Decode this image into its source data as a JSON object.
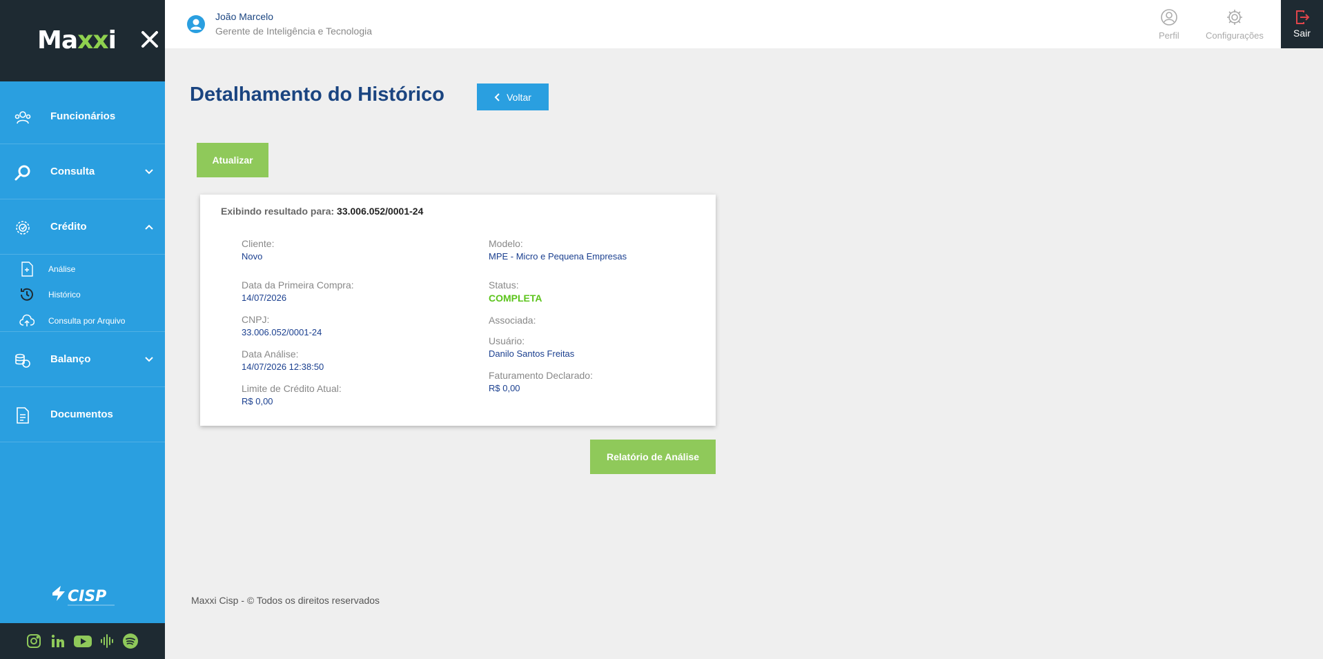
{
  "brand": {
    "logo_pre": "Ma",
    "logo_xx": "xx",
    "logo_post": "i",
    "accent": "#8fd14f"
  },
  "sidebar": {
    "items": [
      {
        "label": "Funcionários",
        "icon": "users-icon"
      },
      {
        "label": "Consulta",
        "icon": "search-icon"
      },
      {
        "label": "Crédito",
        "icon": "credit-gear-icon"
      },
      {
        "label": "Balanço",
        "icon": "coins-icon"
      },
      {
        "label": "Documentos",
        "icon": "document-icon"
      }
    ],
    "sub_items": [
      {
        "label": "Análise",
        "icon": "add-document-icon"
      },
      {
        "label": "Histórico",
        "icon": "history-icon"
      },
      {
        "label": "Consulta por Arquivo",
        "icon": "cloud-upload-icon"
      }
    ],
    "social": [
      "instagram-icon",
      "linkedin-icon",
      "youtube-icon",
      "podcast-icon",
      "spotify-icon"
    ]
  },
  "header": {
    "user_name": "João Marcelo",
    "user_role": "Gerente de Inteligência e Tecnologia",
    "perfil": "Perfil",
    "config": "Configurações",
    "sair": "Sair"
  },
  "main": {
    "title": "Detalhamento do Histórico",
    "back": "Voltar",
    "refresh": "Atualizar",
    "report": "Relatório de Análise",
    "result_prefix": "Exibindo resultado para:",
    "result_doc": "33.006.052/0001-24",
    "left": [
      {
        "k": "Cliente:",
        "v": "Novo"
      },
      {
        "k": "Data da Primeira Compra:",
        "v": "14/07/2026"
      },
      {
        "k": "CNPJ:",
        "v": "33.006.052/0001-24"
      },
      {
        "k": "Data Análise:",
        "v": "14/07/2026 12:38:50"
      },
      {
        "k": "Limite de Crédito Atual:",
        "v": "R$ 0,00"
      }
    ],
    "right": [
      {
        "k": "Modelo:",
        "v": "MPE - Micro e Pequena Empresas"
      },
      {
        "k": "Status:",
        "v": "COMPLETA"
      },
      {
        "k": "Associada:",
        "v": ""
      },
      {
        "k": "Usuário:",
        "v": "Danilo Santos Freitas"
      },
      {
        "k": "Faturamento Declarado:",
        "v": "R$ 0,00"
      }
    ]
  },
  "footer": "Maxxi Cisp - © Todos os direitos reservados",
  "colors": {
    "sidebar": "#2a9fe0",
    "dark": "#1e2a32",
    "green": "#8fc95a",
    "title": "#1a4480",
    "status_ok": "#5cc41c"
  }
}
